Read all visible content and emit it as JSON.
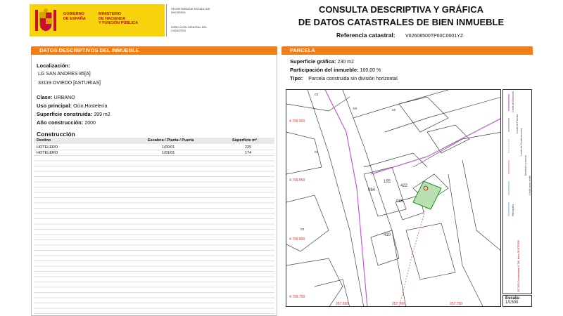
{
  "header": {
    "gov_line1": "GOBIERNO",
    "gov_line2": "DE ESPAÑA",
    "ministry_line1": "MINISTERIO",
    "ministry_line2": "DE HACIENDA",
    "ministry_line3": "Y FUNCIÓN PÚBLICA",
    "secretaria": "SECRETARÍA DE ESTADO DE HACIENDA",
    "direccion": "DIRECCIÓN GENERAL DEL CATASTRO",
    "title_line1": "CONSULTA DESCRIPTIVA Y GRÁFICA",
    "title_line2": "DE DATOS CATASTRALES DE BIEN INMUEBLE",
    "ref_label": "Referencia catastral:",
    "ref_value": "V02608500TP60C0001YZ",
    "colors": {
      "brand_yellow": "#f6d30c",
      "brand_red": "#b5121b",
      "section_orange": "#f07f1a"
    }
  },
  "left": {
    "section_title": "DATOS DESCRIPTIVOS DEL INMUEBLE",
    "localizacion_label": "Localización:",
    "address_line1": "LG SAN ANDRES 85[A]",
    "address_line2": "33119 OVIEDO [ASTURIAS]",
    "clase_label": "Clase:",
    "clase_value": "URBANO",
    "uso_label": "Uso principal:",
    "uso_value": "Ocio,Hostelería",
    "superficie_label": "Superficie construida:",
    "superficie_value": "399 m2",
    "anio_label": "Año construcción:",
    "anio_value": "2000",
    "construccion_title": "Construcción",
    "table": {
      "headers": [
        "Destino",
        "Escalera / Planta / Puerta",
        "Superficie m²"
      ],
      "rows": [
        [
          "HOTELERO",
          "1/00/01",
          "225"
        ],
        [
          "HOTELERO",
          "1/01/01",
          "174"
        ]
      ]
    }
  },
  "right": {
    "section_title": "PARCELA",
    "sup_grafica_label": "Superficie gráfica:",
    "sup_grafica_value": "230 m2",
    "participacion_label": "Participación del inmueble:",
    "participacion_value": "100,00 %",
    "tipo_label": "Tipo:",
    "tipo_value": "Parcela construida sin división horizontal",
    "map": {
      "parcel_labels": [
        "084",
        "155",
        "422",
        "085",
        "419",
        "co",
        "co",
        "co",
        "co",
        "co"
      ],
      "coord_labels_y": [
        "4.799.900",
        "4.799.850",
        "4.799.800",
        "4.799.750"
      ],
      "coord_labels_x": [
        "257.650",
        "257.700",
        "257.750"
      ]
    },
    "legend_items": [
      "Límite de Manzana",
      "Límite de Parcela",
      "Límite de Construcciones",
      "Mobiliario y aceras",
      "Límite zona verde",
      "Hidrografía"
    ],
    "legend_note": "257,800 Coordenadas U.T.M. Huso 30 ETRS89",
    "escala_label": "Escala:",
    "escala_value": "1/1500"
  }
}
